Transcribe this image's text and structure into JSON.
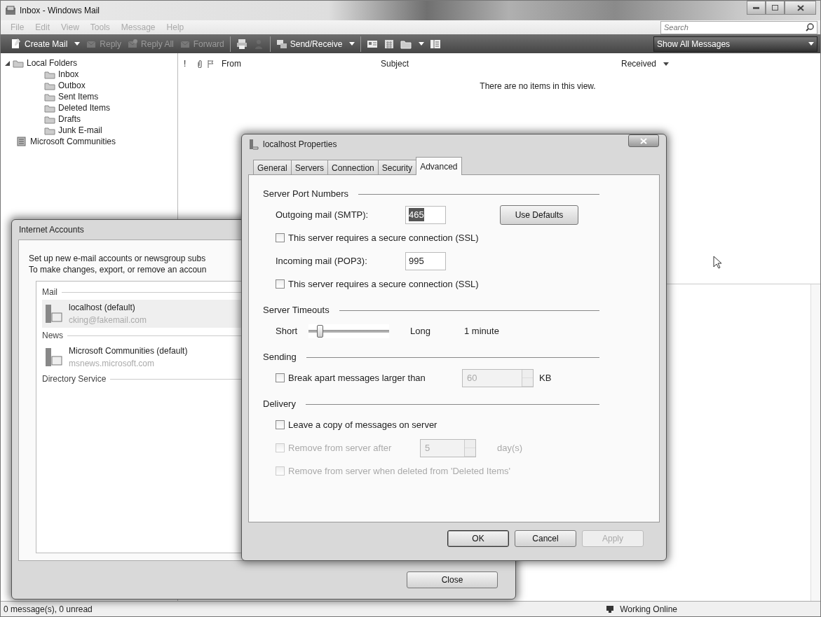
{
  "window": {
    "title": "Inbox - Windows Mail"
  },
  "menu": [
    "File",
    "Edit",
    "View",
    "Tools",
    "Message",
    "Help"
  ],
  "search": {
    "placeholder": "Search"
  },
  "toolbar": [
    {
      "kind": "button",
      "label": "Create Mail",
      "dropdown": true,
      "disabled": false
    },
    {
      "kind": "button",
      "label": "Reply",
      "dropdown": false,
      "disabled": true
    },
    {
      "kind": "button",
      "label": "Reply All",
      "dropdown": false,
      "disabled": true
    },
    {
      "kind": "button",
      "label": "Forward",
      "dropdown": false,
      "disabled": true
    },
    {
      "kind": "separator"
    },
    {
      "kind": "icon",
      "dropdown": false,
      "disabled": false
    },
    {
      "kind": "icon",
      "dropdown": false,
      "disabled": true
    },
    {
      "kind": "separator"
    },
    {
      "kind": "button",
      "label": "Send/Receive",
      "dropdown": true,
      "disabled": false
    },
    {
      "kind": "separator"
    },
    {
      "kind": "icon",
      "dropdown": false,
      "disabled": false
    },
    {
      "kind": "icon",
      "dropdown": false,
      "disabled": false
    },
    {
      "kind": "icon",
      "dropdown": true,
      "disabled": false
    },
    {
      "kind": "icon",
      "dropdown": false,
      "disabled": false
    }
  ],
  "view_filter": {
    "value": "Show All Messages"
  },
  "folders": [
    {
      "label": "Local Folders",
      "expanded": true,
      "children": [
        {
          "label": "Inbox"
        },
        {
          "label": "Outbox"
        },
        {
          "label": "Sent Items"
        },
        {
          "label": "Deleted Items"
        },
        {
          "label": "Drafts"
        },
        {
          "label": "Junk E-mail"
        }
      ]
    },
    {
      "label": "Microsoft Communities"
    }
  ],
  "message_list": {
    "columns": [
      {
        "kind": "text",
        "label": "!"
      },
      {
        "kind": "attachment"
      },
      {
        "kind": "flag"
      },
      {
        "kind": "text",
        "label": "From"
      },
      {
        "kind": "text",
        "label": "Subject"
      },
      {
        "kind": "text",
        "label": "Received",
        "sorted": true
      }
    ],
    "empty_text": "There are no items in this view."
  },
  "status_bar": {
    "left": "0 message(s), 0 unread",
    "right": "Working Online"
  },
  "accounts_dialog": {
    "title": "Internet Accounts",
    "intro": [
      "Set up new e-mail accounts or newsgroup subs",
      "To make changes, export, or remove an accoun"
    ],
    "groups": [
      {
        "label": "Mail",
        "accounts": [
          {
            "name": "localhost (default)",
            "address": "cking@fakemail.com",
            "selected": true
          }
        ]
      },
      {
        "label": "News",
        "accounts": [
          {
            "name": "Microsoft Communities (default)",
            "address": "msnews.microsoft.com",
            "selected": false
          }
        ]
      },
      {
        "label": "Directory Service"
      }
    ],
    "buttons": [
      "Close"
    ]
  },
  "properties_dialog": {
    "title": "localhost Properties",
    "tabs": [
      {
        "label": "General",
        "selected": false
      },
      {
        "label": "Servers",
        "selected": false
      },
      {
        "label": "Connection",
        "selected": false
      },
      {
        "label": "Security",
        "selected": false
      },
      {
        "label": "Advanced",
        "selected": true
      }
    ],
    "sections": [
      {
        "title": "Server Port Numbers",
        "items": [
          {
            "kind": "port",
            "label": "Outgoing mail (SMTP):",
            "value": "465",
            "text_selected": true,
            "button": "Use Defaults"
          },
          {
            "kind": "checkbox",
            "label": "This server requires a secure connection (SSL)",
            "checked": false,
            "disabled": false
          },
          {
            "kind": "port",
            "label": "Incoming mail (POP3):",
            "value": "995",
            "text_selected": false
          },
          {
            "kind": "checkbox",
            "label": "This server requires a secure connection (SSL)",
            "checked": false,
            "disabled": false
          }
        ]
      },
      {
        "title": "Server Timeouts",
        "items": [
          {
            "kind": "slider",
            "min_label": "Short",
            "max_label": "Long",
            "level": 0.15,
            "reading": "1 minute"
          }
        ]
      },
      {
        "title": "Sending",
        "items": [
          {
            "kind": "spin",
            "label": "Break apart messages larger than",
            "checked": false,
            "disabled": false,
            "value": "60",
            "value_disabled": true,
            "unit": "KB"
          }
        ]
      },
      {
        "title": "Delivery",
        "items": [
          {
            "kind": "checkbox",
            "label": "Leave a copy of messages on server",
            "checked": false,
            "disabled": false,
            "children": [
              {
                "kind": "spin",
                "label": "Remove from server after",
                "checked": false,
                "disabled": true,
                "value": "5",
                "value_disabled": true,
                "unit": "day(s)"
              },
              {
                "kind": "checkbox",
                "label": "Remove from server when deleted from 'Deleted Items'",
                "checked": false,
                "disabled": true
              }
            ]
          }
        ]
      }
    ],
    "buttons": [
      {
        "label": "OK",
        "disabled": false,
        "default": true
      },
      {
        "label": "Cancel",
        "disabled": false,
        "default": false
      },
      {
        "label": "Apply",
        "disabled": true,
        "default": false
      }
    ]
  }
}
